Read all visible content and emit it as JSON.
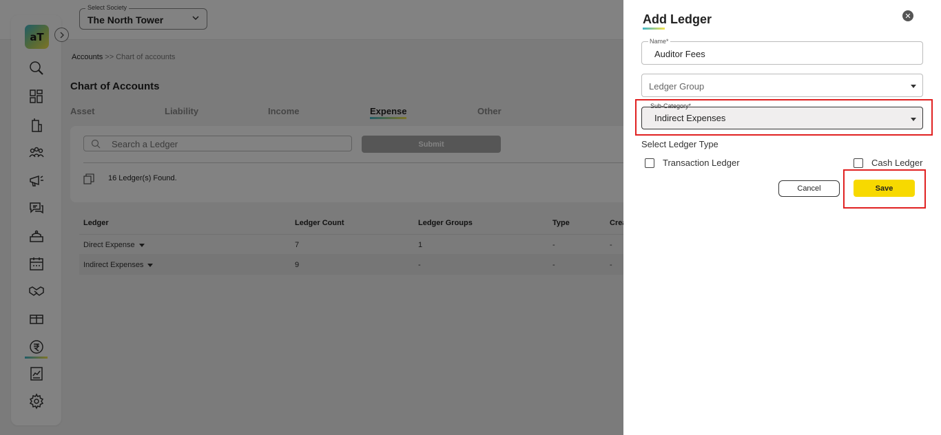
{
  "society": {
    "label": "Select Society",
    "value": "The North Tower"
  },
  "breadcrumb": {
    "root": "Accounts",
    "separator": " >> ",
    "current": "Chart of accounts"
  },
  "page": {
    "title": "Chart of Accounts"
  },
  "tabs": [
    {
      "label": "Asset"
    },
    {
      "label": "Liability"
    },
    {
      "label": "Income"
    },
    {
      "label": "Expense",
      "active": true
    },
    {
      "label": "Other"
    }
  ],
  "search": {
    "placeholder": "Search a Ledger",
    "submit_label": "Submit"
  },
  "found_text": "16 Ledger(s) Found.",
  "table": {
    "headers": [
      "Ledger",
      "Ledger Count",
      "Ledger Groups",
      "Type",
      "Crea"
    ],
    "rows": [
      [
        "Direct Expense",
        "7",
        "1",
        "-",
        "-"
      ],
      [
        "Indirect Expenses",
        "9",
        "-",
        "-",
        "-"
      ]
    ]
  },
  "sidebar": {
    "logo_text": "aT",
    "icons": [
      "search-icon",
      "dashboard-icon",
      "building-icon",
      "members-icon",
      "announcement-icon",
      "chat-icon",
      "service-icon",
      "calendar-icon",
      "handshake-icon",
      "parcel-icon",
      "rupee-icon",
      "report-icon",
      "settings-icon"
    ],
    "active": "rupee-icon"
  },
  "drawer": {
    "title": "Add Ledger",
    "name_field": {
      "label": "Name*",
      "value": "Auditor Fees"
    },
    "ledger_group": {
      "placeholder": "Ledger Group"
    },
    "sub_category": {
      "label": "Sub-Category*",
      "value": "Indirect Expenses"
    },
    "ledger_type_label": "Select Ledger Type",
    "checkbox_transaction": {
      "label": "Transaction Ledger",
      "checked": false
    },
    "checkbox_cash": {
      "label": "Cash Ledger",
      "checked": false
    },
    "cancel_label": "Cancel",
    "save_label": "Save"
  },
  "colors": {
    "accent_yellow": "#f7d900",
    "highlight_red": "#e02020",
    "overlay": "rgba(0,0,0,0.49)"
  }
}
